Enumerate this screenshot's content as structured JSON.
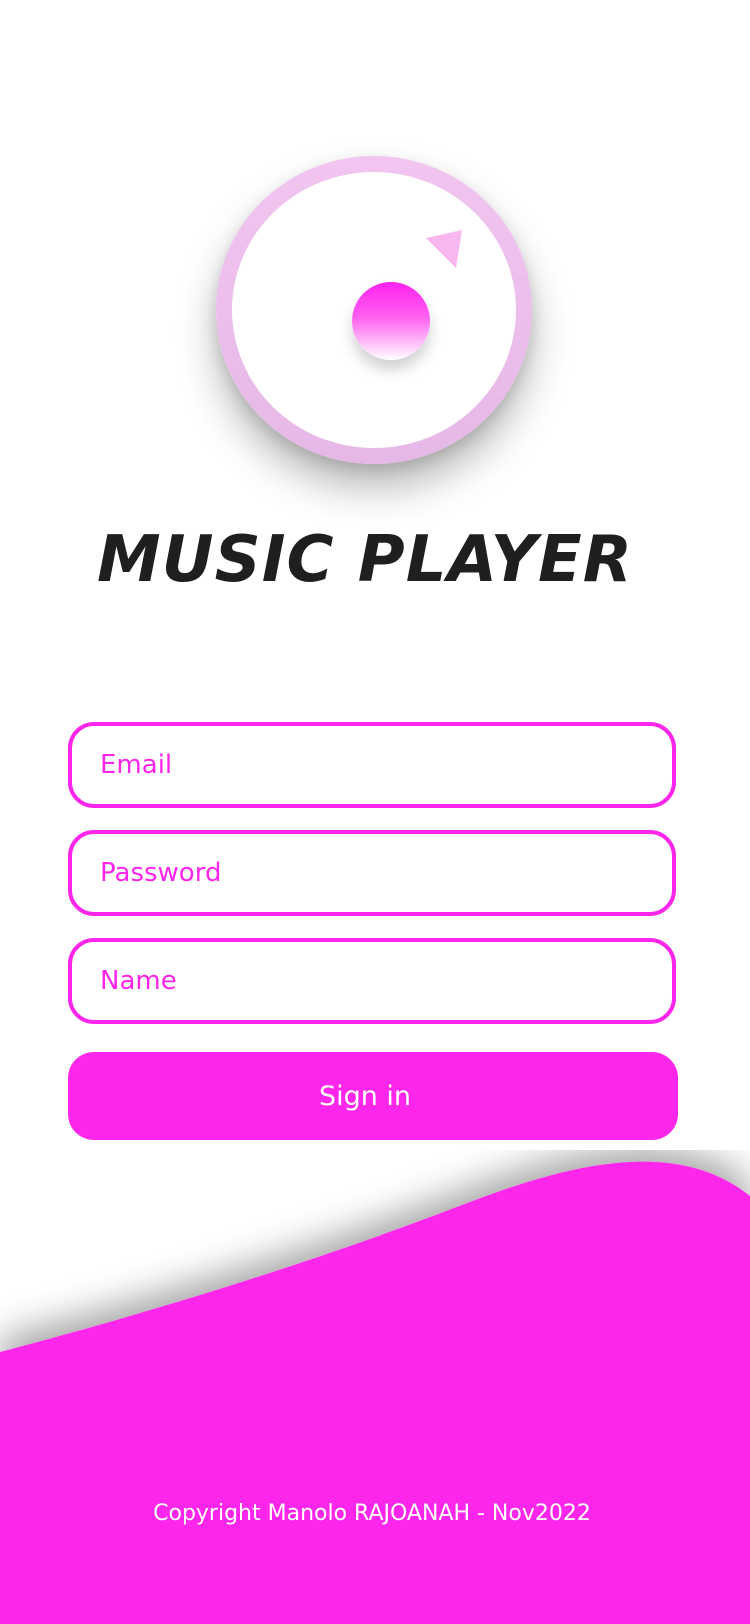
{
  "app": {
    "title": "MUSIC PLAYER"
  },
  "logo": {
    "icon": "music-disc-icon",
    "play_icon": "play-triangle-icon"
  },
  "form": {
    "email_placeholder": "Email",
    "password_placeholder": "Password",
    "name_placeholder": "Name",
    "signin_label": "Sign in"
  },
  "footer": {
    "copyright": "Copyright Manolo RAJOANAH - Nov2022"
  },
  "colors": {
    "accent": "#ff26ec",
    "logo_ring": "#f2c4f0",
    "title_text": "#1f1f1f",
    "background": "#ffffff"
  }
}
